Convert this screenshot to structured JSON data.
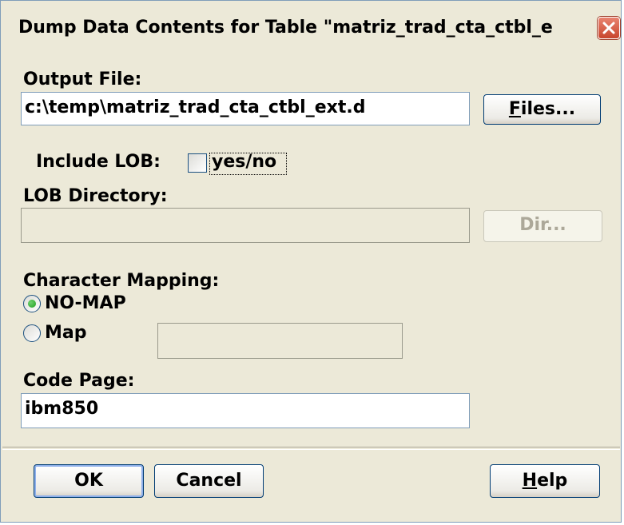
{
  "dialog": {
    "title": "Dump Data Contents for Table \"matriz_trad_cta_ctbl_e"
  },
  "output_file": {
    "label": "Output File:",
    "value": "c:\\temp\\matriz_trad_cta_ctbl_ext.d",
    "files_button_mnemonic": "F",
    "files_button_rest": "iles..."
  },
  "lob": {
    "include_label": "Include LOB:",
    "checkbox_label": "yes/no",
    "checked": false,
    "directory_label": "LOB Directory:",
    "directory_value": "",
    "dir_button": "Dir..."
  },
  "character_mapping": {
    "label": "Character Mapping:",
    "options": [
      {
        "label": "NO-MAP",
        "selected": true
      },
      {
        "label": "Map",
        "selected": false
      }
    ],
    "map_value": ""
  },
  "code_page": {
    "label": "Code Page:",
    "value": "ibm850"
  },
  "buttons": {
    "ok": "OK",
    "cancel": "Cancel",
    "help_mnemonic": "H",
    "help_rest": "elp"
  },
  "colors": {
    "dialog_bg": "#ece9d8",
    "field_border": "#7f9db9",
    "close_button": "#c8452d",
    "radio_selected": "#21a121"
  }
}
